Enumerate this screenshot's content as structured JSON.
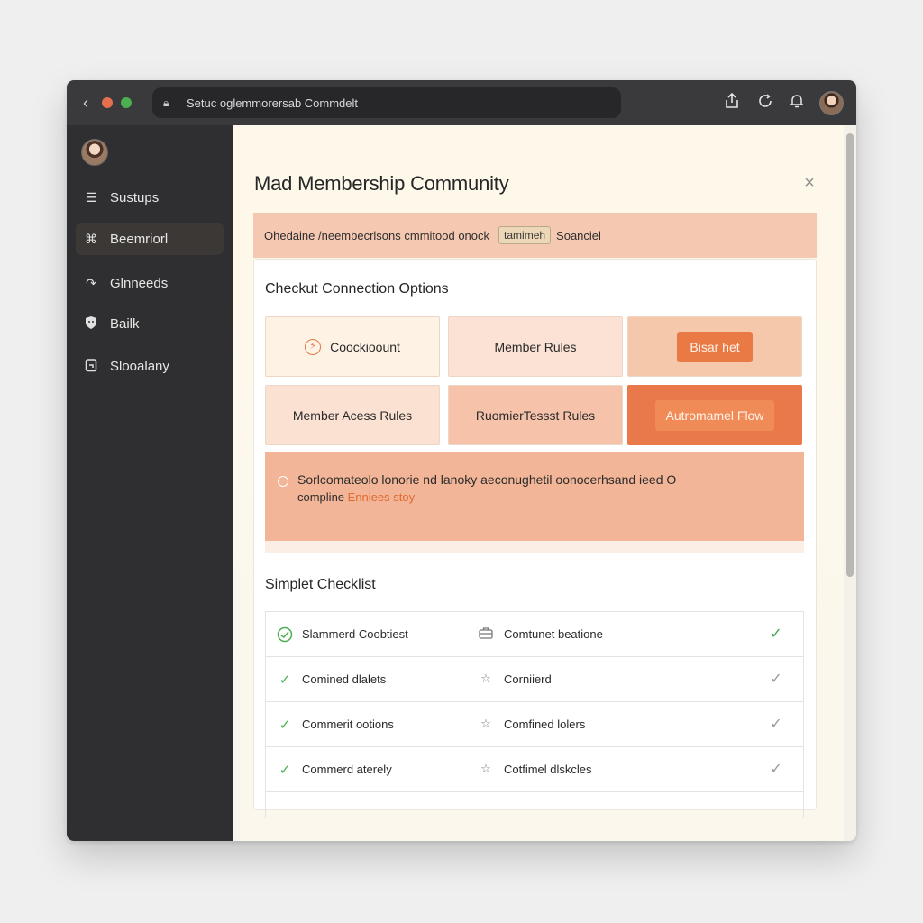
{
  "browser": {
    "url": "Setuc oglemmorersab Commdelt"
  },
  "sidebar": {
    "items": [
      {
        "label": "Sustups",
        "icon": "list-icon"
      },
      {
        "label": "Beemriorl",
        "icon": "puzzle-icon"
      },
      {
        "label": "Glnneeds",
        "icon": "share-arrow-icon"
      },
      {
        "label": "Bailk",
        "icon": "shield-icon"
      },
      {
        "label": "Slooalany",
        "icon": "clipboard-icon"
      }
    ]
  },
  "main": {
    "title": "Mad Membership Community",
    "banner": {
      "text": "Ohedaine /​neembecrlsons cmmitood onock",
      "tag": "tamimeh",
      "link": "Soanciel"
    },
    "section1_title": "Checkut Connection Options",
    "options": {
      "row1": [
        "Coockioount",
        "Member Rules",
        "Bisar het"
      ],
      "row2": [
        "Member Acess Rules",
        "RuomierTessst Rules",
        "Autromamel Flow"
      ]
    },
    "notice": {
      "line1": "Sorlcomateolo lonorie nd lanoky aeconughetil oonocerhsand ieed O",
      "line2_prefix": "compline ",
      "line2_link": "Enniees stoy"
    },
    "section2_title": "Simplet Checklist",
    "checklist": [
      {
        "left": "Slammerd Coobtiest",
        "right": "Comtunet beatione",
        "done": true
      },
      {
        "left": "Comined dlalets",
        "right": "Corniierd",
        "done": false
      },
      {
        "left": "Commerit ootions",
        "right": "Comfined lolers",
        "done": false
      },
      {
        "left": "Commerd aterely",
        "right": "Cotfimel dlskcles",
        "done": false
      }
    ]
  },
  "colors": {
    "accent": "#ea7a45",
    "titlebar": "#3a3a3c",
    "sidebar": "#2f2f31",
    "banner": "#f5c8b2",
    "check": "#4caf50",
    "dot_red": "#e76f51",
    "dot_green": "#4caf50"
  }
}
